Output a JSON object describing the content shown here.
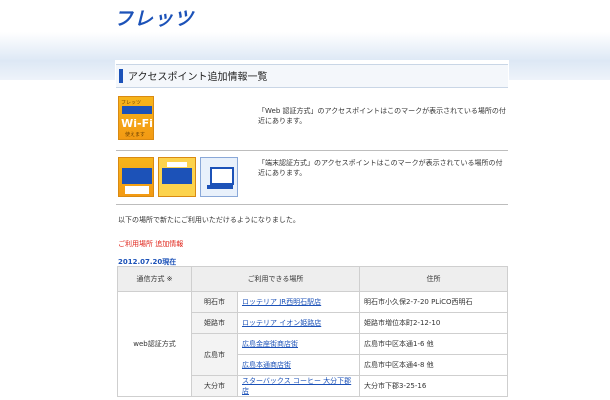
{
  "brand": {
    "logo_text": "フレッツ"
  },
  "page": {
    "title": "アクセスポイント追加情報一覧"
  },
  "notes": {
    "web_auth": "「Web 認証方式」のアクセスポイントはこのマークが表示されている場所の付近にあります。",
    "terminal_auth": "「端末認証方式」のアクセスポイントはこのマークが表示されている場所の付近にあります。",
    "intro": "以下の場所で新たにご利用いただけるようになりました。"
  },
  "section_label": "ご利用場所 追加情報",
  "date": "2012.07.20現在",
  "icons": {
    "wifi": {
      "top_text": "フレッツ",
      "main_text": "Wi-Fi",
      "bottom_text": "使えます"
    },
    "names": [
      "wifi-badge-icon",
      "spot-badge-icon",
      "internet-badge-icon",
      "pc-badge-icon"
    ]
  },
  "table": {
    "headers": [
      "通信方式 ※",
      "ご利用できる場所",
      "住所"
    ],
    "method": "web認証方式",
    "rows": [
      {
        "city": "明石市",
        "place": "ロッテリア JR西明石駅店",
        "address": "明石市小久保2-7-20 PLiCO西明石"
      },
      {
        "city": "姫路市",
        "place": "ロッテリア イオン姫路店",
        "address": "姫路市増位本町2-12-10"
      },
      {
        "city": "広島市",
        "place": "広島金座街商店街",
        "address": "広島市中区本通1-6 他"
      },
      {
        "city": "",
        "place": "広島本通商店街",
        "address": "広島市中区本通4-8 他"
      },
      {
        "city": "大分市",
        "place": "スターバックス コーヒー 大分下郡店",
        "address": "大分市下郡3-25-16"
      }
    ]
  },
  "colors": {
    "brand_blue": "#1c52b8",
    "accent_red": "#e0251b",
    "badge_orange": "#f39a13"
  }
}
